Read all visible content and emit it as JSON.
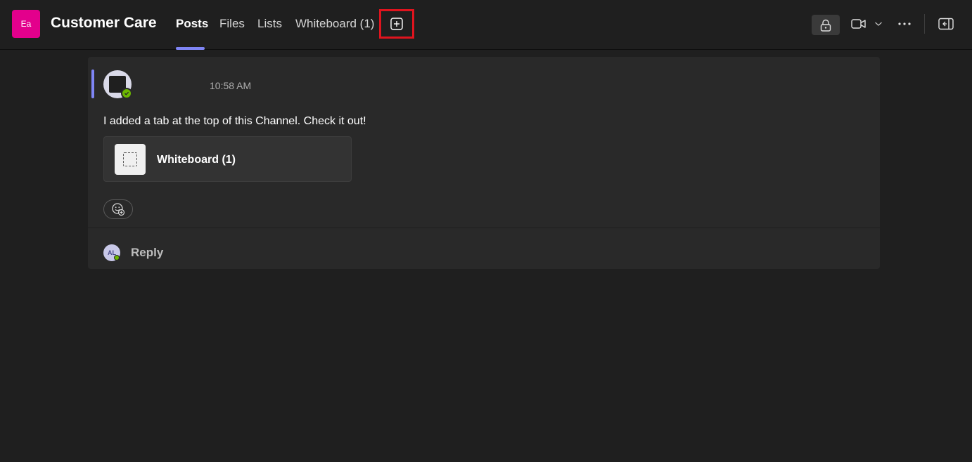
{
  "header": {
    "team_initials": "Ea",
    "channel_name": "Customer Care",
    "tabs": [
      {
        "label": "Posts",
        "active": true
      },
      {
        "label": "Files",
        "active": false
      },
      {
        "label": "Lists",
        "active": false
      },
      {
        "label": "Whiteboard (1)",
        "active": false
      }
    ],
    "icons": {
      "add_tab": "plus-square-icon",
      "lock": "lock-icon",
      "video": "video-camera-icon",
      "chevron": "chevron-down-icon",
      "more": "more-horizontal-icon",
      "panel": "open-panel-icon"
    }
  },
  "post": {
    "timestamp": "10:58 AM",
    "message": "I added a tab at the top of this Channel. Check it out!",
    "attachment": {
      "title": "Whiteboard (1)",
      "icon": "whiteboard-icon"
    },
    "reaction_icon": "add-reaction-icon",
    "reply": {
      "avatar_initials": "AL",
      "label": "Reply"
    }
  },
  "colors": {
    "background": "#1f1f1f",
    "card": "#292929",
    "accent": "#7f85f5",
    "team_avatar": "#e3008c",
    "presence": "#6bb700",
    "highlight": "#e0141e"
  }
}
